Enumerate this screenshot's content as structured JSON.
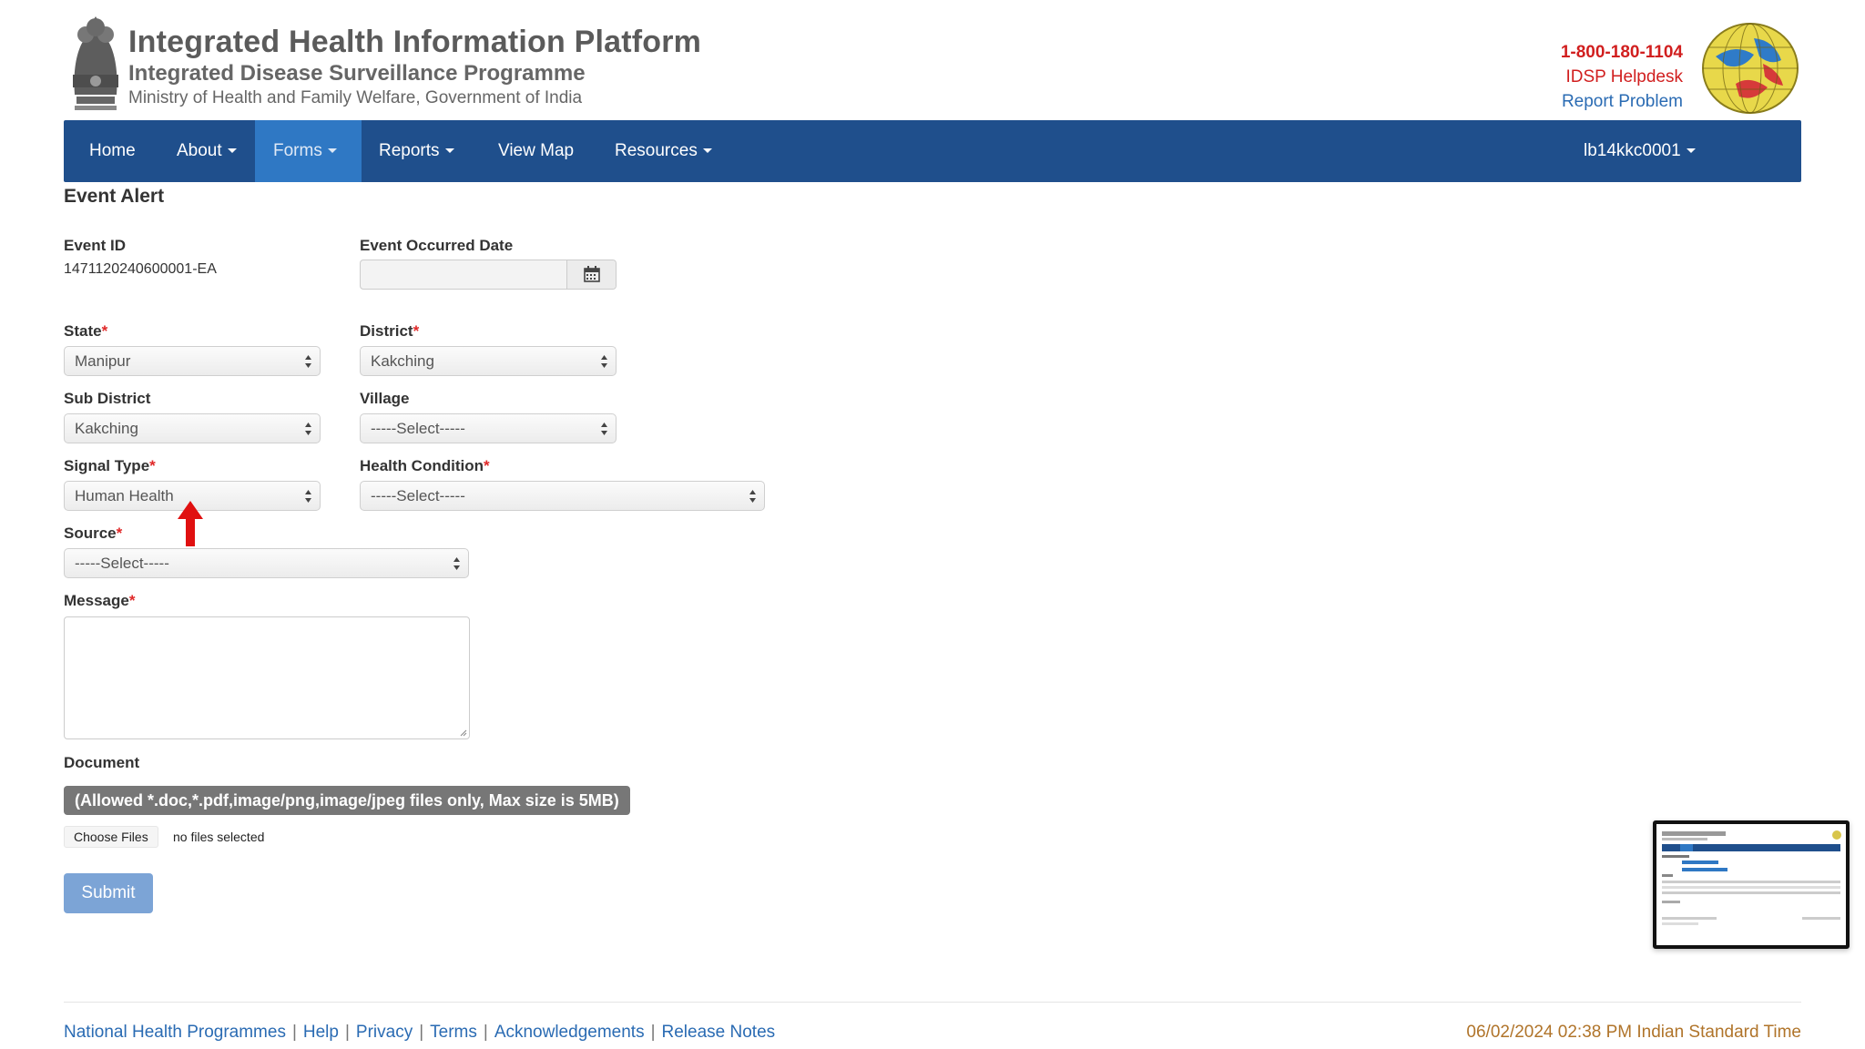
{
  "header": {
    "title": "Integrated Health Information Platform",
    "subtitle": "Integrated Disease Surveillance Programme",
    "ministry": "Ministry of Health and Family Welfare, Government of India",
    "phone": "1-800-180-1104",
    "helpdesk": "IDSP Helpdesk",
    "report_problem": "Report Problem"
  },
  "nav": {
    "items": [
      {
        "label": "Home",
        "dropdown": false
      },
      {
        "label": "About",
        "dropdown": true
      },
      {
        "label": "Forms",
        "dropdown": true,
        "active": true
      },
      {
        "label": "Reports",
        "dropdown": true
      },
      {
        "label": "View Map",
        "dropdown": false
      },
      {
        "label": "Resources",
        "dropdown": true
      }
    ],
    "user": "lb14kkc0001"
  },
  "form": {
    "title": "Event Alert",
    "event_id_label": "Event ID",
    "event_id_value": "1471120240600001-EA",
    "event_date_label": "Event Occurred Date",
    "event_date_value": "",
    "state_label": "State",
    "state_value": "Manipur",
    "district_label": "District",
    "district_value": "Kakching",
    "subdistrict_label": "Sub District",
    "subdistrict_value": "Kakching",
    "village_label": "Village",
    "village_value": "-----Select-----",
    "signal_type_label": "Signal Type",
    "signal_type_value": "Human Health",
    "health_condition_label": "Health Condition",
    "health_condition_value": "-----Select-----",
    "source_label": "Source",
    "source_value": "-----Select-----",
    "message_label": "Message",
    "message_value": "",
    "document_label": "Document",
    "document_note": "(Allowed *.doc,*.pdf,image/png,image/jpeg files only, Max size is 5MB)",
    "choose_files": "Choose Files",
    "no_files": "no files selected",
    "submit": "Submit"
  },
  "footer": {
    "links": [
      "National Health Programmes",
      "Help",
      "Privacy",
      "Terms",
      "Acknowledgements",
      "Release Notes"
    ],
    "timestamp": "06/02/2024 02:38 PM Indian Standard Time"
  },
  "colors": {
    "navbar": "#1f4f8c",
    "nav_active": "#2f78c4",
    "required": "#e02828",
    "link": "#2a6bb3",
    "helpline": "#d11f1f",
    "timestamp": "#b0742a"
  }
}
